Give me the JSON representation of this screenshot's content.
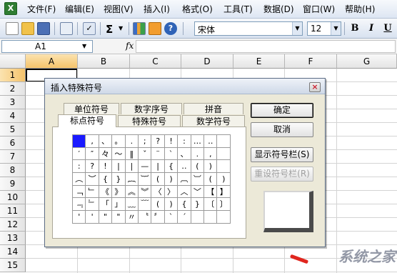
{
  "app_icon": "X",
  "menu": [
    "文件(F)",
    "编辑(E)",
    "视图(V)",
    "插入(I)",
    "格式(O)",
    "工具(T)",
    "数据(D)",
    "窗口(W)",
    "帮助(H)"
  ],
  "toolbar": {
    "sigma": "Σ",
    "font_name": "宋体",
    "font_size": "12",
    "bold": "B",
    "italic": "I",
    "underline": "U"
  },
  "formula_bar": {
    "cell_ref": "A1",
    "fx": "fx"
  },
  "grid": {
    "columns": [
      "A",
      "B",
      "C",
      "D",
      "E",
      "F",
      "G"
    ],
    "rows": [
      "1",
      "2",
      "3",
      "4",
      "5",
      "6",
      "7",
      "8",
      "9",
      "10",
      "11",
      "12",
      "13",
      "14",
      "15"
    ]
  },
  "dialog": {
    "title": "插入特殊符号",
    "close": "×",
    "tabs_back": [
      "单位符号",
      "数字序号",
      "拼音"
    ],
    "tabs_front": [
      "标点符号",
      "特殊符号",
      "数学符号"
    ],
    "symbols": [
      [
        "",
        ",",
        "、",
        "。",
        ".",
        ";",
        "?",
        "!",
        ":",
        "…",
        "‥"
      ],
      [
        "′",
        "″",
        "々",
        "～",
        "‖",
        "ˇ",
        "¨",
        "`",
        "、",
        ".",
        ","
      ],
      [
        ":",
        "?",
        "!",
        "|",
        "|",
        "—",
        "|",
        "{",
        "‥",
        "(",
        ")"
      ],
      [
        "︵",
        "︶",
        "{",
        "}",
        "︷",
        "︸",
        "(",
        ")",
        "︹",
        "︺",
        "(",
        ")"
      ],
      [
        "﹁",
        "﹂",
        "《",
        "》",
        "︽",
        "︾",
        "〈",
        "〉",
        "︿",
        "﹀",
        "【",
        "】"
      ],
      [
        "﹃",
        "﹄",
        "「",
        "」",
        "﹏",
        "﹋",
        "(",
        ")",
        "{",
        "}",
        "〔",
        "〕"
      ],
      [
        "'",
        "'",
        "\"",
        "\"",
        "〃",
        "〝",
        "〞",
        "ˋ",
        "ˊ",
        "",
        ""
      ]
    ],
    "buttons": {
      "ok": "确定",
      "cancel": "取消",
      "show_bar": "显示符号栏(S)",
      "reset_bar": "重设符号栏(R)"
    }
  },
  "watermark": "系统之家"
}
